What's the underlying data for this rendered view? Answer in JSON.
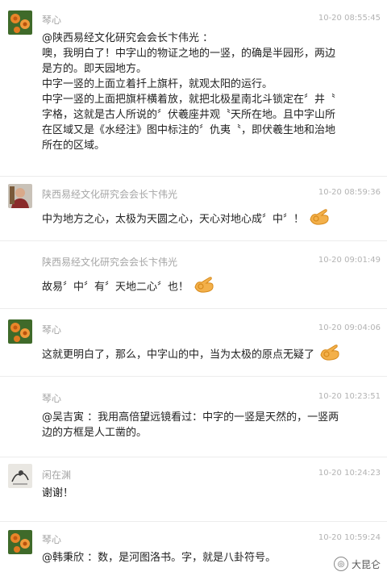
{
  "comments": [
    {
      "name": "琴心",
      "time": "10-20 08:55:45",
      "avatar": "flower-avatar",
      "lines": [
        "@陕西易经文化研究会会长卞伟光 ：",
        "噢，我明白了！中字山的物证之地的一竖，的确是半园形，两边",
        "是方的。即天园地方。",
        "中字一竖的上面立着扦上旗杆，就观太阳的运行。",
        "中字一竖的上面把旗杆横着放，就把北极星南北斗锁定在〞井〝",
        "字格，这就是古人所说的〞伏羲座井观〝天所在地。且中字山所",
        "在区域又是《水经注》图中标注的〞仇夷〝，即伏羲生地和治地",
        "所在的区域。"
      ]
    },
    {
      "name": "陕西易经文化研究会会长卞伟光",
      "time": "10-20 08:59:36",
      "avatar": "portrait-avatar",
      "lines": [
        "中为地方之心，太极为天圆之心，天心对地心成〞中〞！"
      ],
      "emoji": "ok-hand-emoji"
    },
    {
      "name": "陕西易经文化研究会会长卞伟光",
      "time": "10-20 09:01:49",
      "avatar": "",
      "lines": [
        "故易〞中〞有〞天地二心〞也！"
      ],
      "emoji": "ok-hand-emoji"
    },
    {
      "name": "琴心",
      "time": "10-20 09:04:06",
      "avatar": "flower-avatar",
      "lines": [
        "这就更明白了，那么，中字山的中，当为太极的原点无疑了"
      ],
      "emoji": "ok-hand-emoji"
    },
    {
      "name": "琴心",
      "time": "10-20 10:23:51",
      "avatar": "",
      "lines": [
        "@吴吉寅 ：我用高倍望远镜看过：中字的一竖是天然的，一竖两",
        "边的方框是人工凿的。"
      ]
    },
    {
      "name": "闲在渊",
      "time": "10-20 10:24:23",
      "avatar": "sketch-avatar",
      "lines": [
        "谢谢！"
      ]
    },
    {
      "name": "琴心",
      "time": "10-20 10:59:24",
      "avatar": "flower-avatar",
      "lines": [
        "@韩秉欣 ：数，是河图洛书。字，就是八卦符号。"
      ]
    }
  ],
  "watermark": {
    "text": "大昆仑",
    "icon": "wechat-channel-icon"
  }
}
